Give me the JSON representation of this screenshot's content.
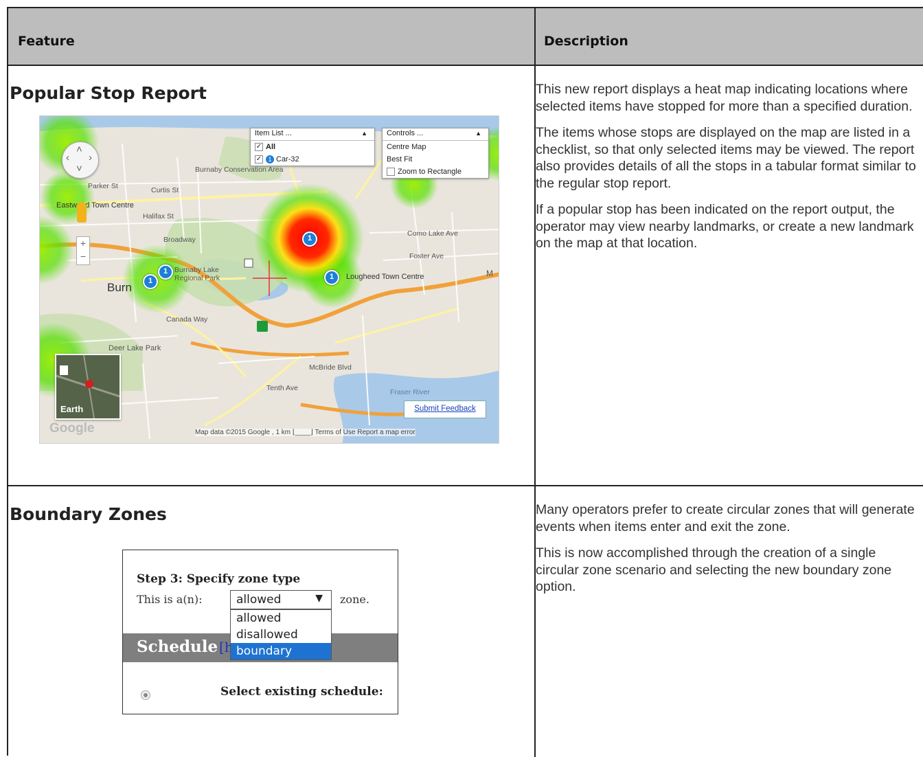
{
  "headers": {
    "feature": "Feature",
    "description": "Description"
  },
  "rows": [
    {
      "title": "Popular Stop Report",
      "paragraphs": [
        "This new report displays a heat map indicating locations where selected items have stopped for more than a specified duration.",
        "The items whose stops are displayed on the map are listed in a checklist, so that only selected items may be viewed. The report also provides details of all the stops in a tabular format similar to the regular stop report.",
        "If a popular stop has been indicated on the report output, the operator may view nearby landmarks, or create a new landmark on the map at that location."
      ],
      "map": {
        "item_list": {
          "title": "Item List ...",
          "all": "All",
          "car": "Car-32"
        },
        "controls": {
          "title": "Controls ...",
          "centre": "Centre Map",
          "best_fit": "Best Fit",
          "zoom_rect": "Zoom to Rectangle"
        },
        "labels": {
          "burnaby_conservation": "Burnaby Conservation Area",
          "eastwood": "Eastwood Town Centre",
          "burnaby_lake": "Burnaby Lake Regional Park",
          "burnaby": "Burn",
          "lougheed": "Lougheed Town Centre",
          "deer_lake": "Deer Lake Park",
          "como_lake": "Como Lake Ave",
          "foster": "Foster Ave",
          "broadway": "Broadway",
          "halifax": "Halifax St",
          "curtis": "Curtis St",
          "parker": "Parker St",
          "canada_way": "Canada Way",
          "tenth": "Tenth Ave",
          "mcbride": "McBride Blvd",
          "fraser": "Fraser River",
          "marker_label": "M"
        },
        "earth": "Earth",
        "feedback": "Submit Feedback",
        "google": "Google",
        "attribution": "Map data ©2015 Google , 1 km ⌊____⌋   Terms of Use   Report a map error",
        "stop_count": "1"
      }
    },
    {
      "title": "Boundary Zones",
      "paragraphs": [
        "Many operators prefer to create circular zones that will generate events when items enter and exit the zone.",
        "This is now accomplished through the creation of a single circular zone scenario and selecting the new boundary zone option."
      ],
      "zone_form": {
        "step": "Step 3: Specify zone type",
        "this_is": "This is a(n):",
        "selected": "allowed",
        "zone_word": "zone.",
        "options": [
          "allowed",
          "disallowed",
          "boundary"
        ],
        "schedule": "Schedule",
        "hide": "[hide]",
        "existing": "Select existing schedule:"
      }
    }
  ]
}
